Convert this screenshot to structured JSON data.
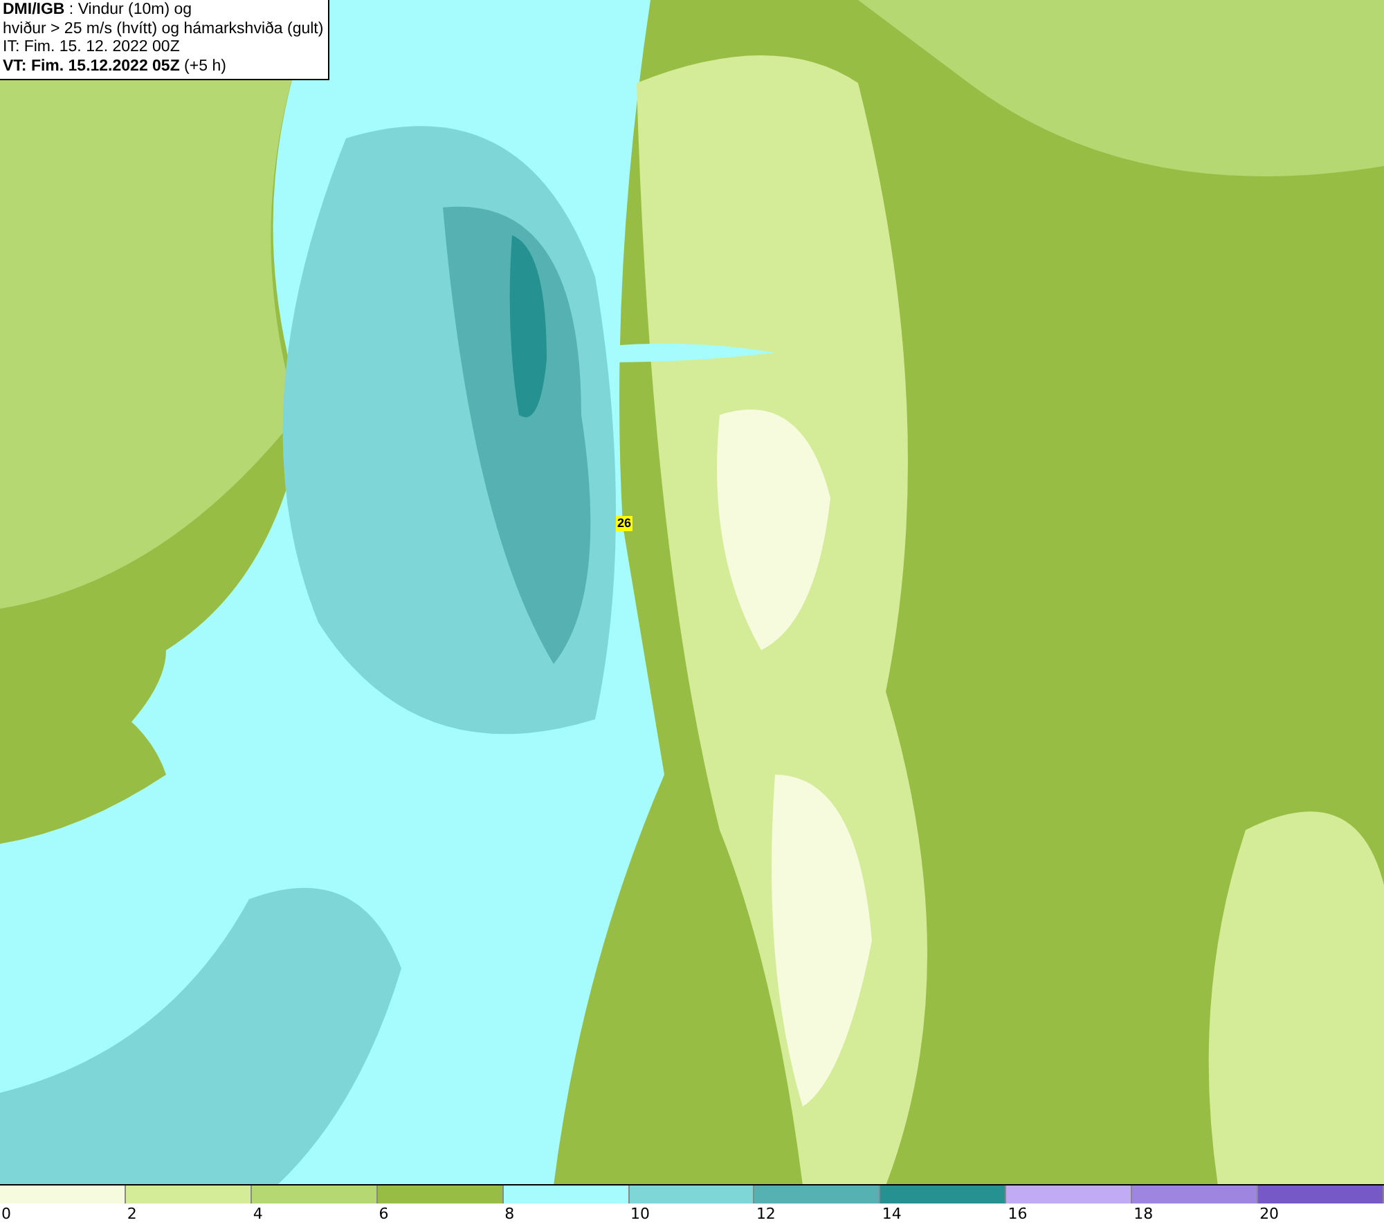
{
  "title_box": {
    "lines": [
      "**DMI/IGB** : Vindur (10m) og",
      "hviður > 25 m/s (hvítt) og hámarkshviða (gult)",
      "IT: Fim. 15. 12. 2022 00Z",
      "**VT: Fim. 15.12.2022 05Z** (+5 h)"
    ]
  },
  "map": {
    "gust_label": "26"
  },
  "legend": {
    "bins": [
      {
        "color": "#f5fbdc"
      },
      {
        "color": "#d4ec98"
      },
      {
        "color": "#b5d873"
      },
      {
        "color": "#98bd45"
      },
      {
        "color": "#a6fcfc"
      },
      {
        "color": "#7fd6d6"
      },
      {
        "color": "#56b2b2"
      },
      {
        "color": "#259191"
      },
      {
        "color": "#c2abf5"
      },
      {
        "color": "#9e85e0"
      },
      {
        "color": "#7658c7"
      }
    ],
    "ticks": [
      "0",
      "2",
      "4",
      "6",
      "8",
      "10",
      "12",
      "14",
      "16",
      "18",
      "20"
    ]
  }
}
